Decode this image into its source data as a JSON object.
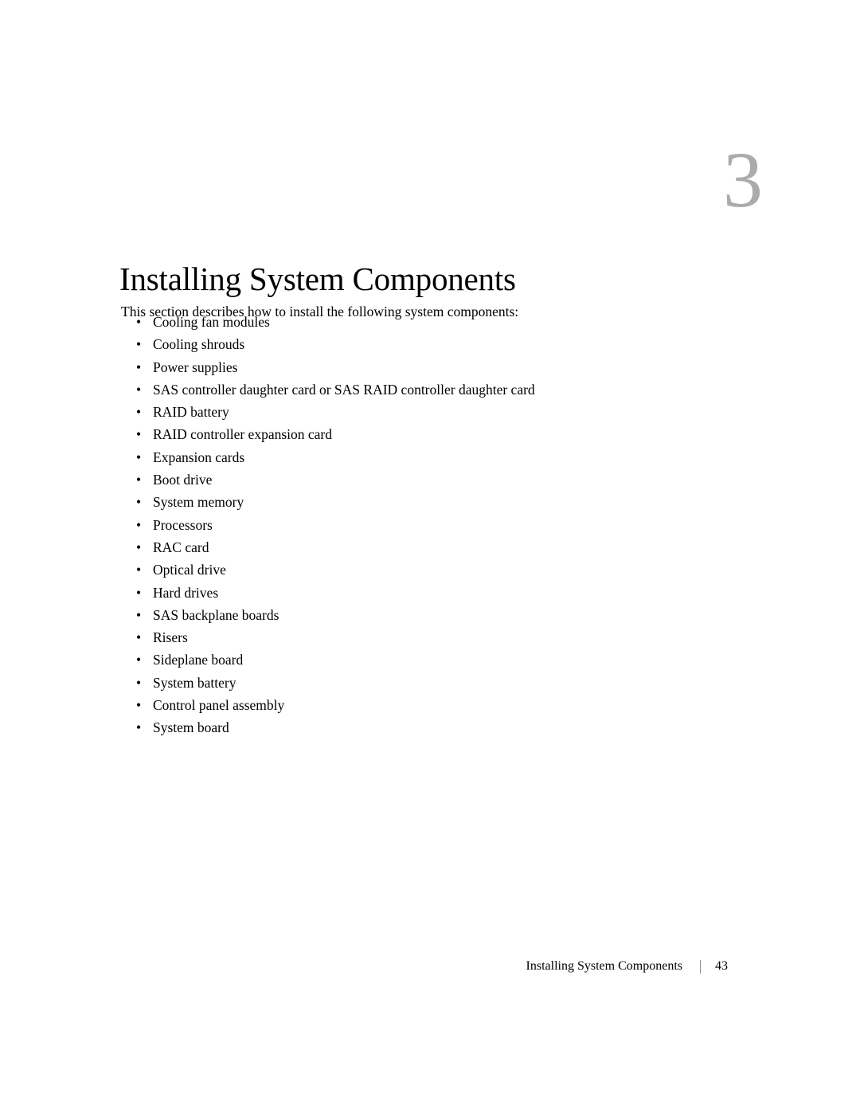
{
  "page": {
    "chapter_number": "3",
    "title": "Installing System Components",
    "intro": "This section describes how to install the following system components:",
    "bullet_glyph": "•"
  },
  "components": [
    {
      "label": "Cooling fan modules"
    },
    {
      "label": "Cooling shrouds"
    },
    {
      "label": "Power supplies"
    },
    {
      "label": "SAS controller daughter card or SAS RAID controller daughter card"
    },
    {
      "label": "RAID battery"
    },
    {
      "label": "RAID controller expansion card"
    },
    {
      "label": "Expansion cards"
    },
    {
      "label": "Boot drive"
    },
    {
      "label": "System memory"
    },
    {
      "label": "Processors"
    },
    {
      "label": "RAC card"
    },
    {
      "label": "Optical drive"
    },
    {
      "label": "Hard drives"
    },
    {
      "label": "SAS backplane boards"
    },
    {
      "label": "Risers"
    },
    {
      "label": "Sideplane board"
    },
    {
      "label": "System battery"
    },
    {
      "label": "Control panel assembly"
    },
    {
      "label": "System board"
    }
  ],
  "footer": {
    "chapter_label": "Installing System Components",
    "page_number": "43"
  },
  "colors": {
    "page_background": "#ffffff",
    "text": "#000000",
    "chapter_number": "#ababab",
    "footer_separator": "#8d8d8d"
  }
}
